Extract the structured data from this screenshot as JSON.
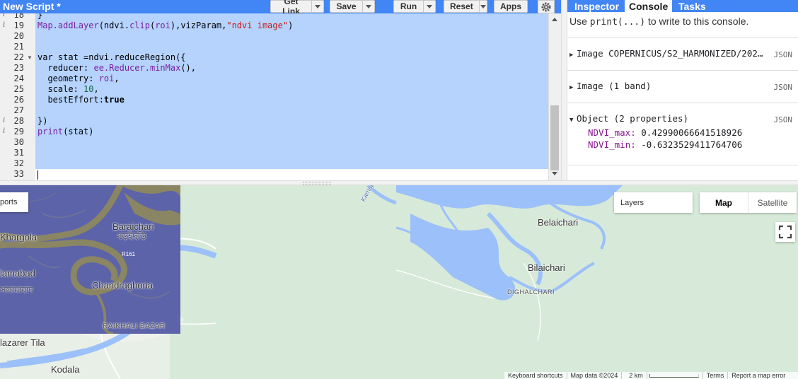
{
  "editor": {
    "title": "New Script *",
    "buttons": {
      "get_link": "Get Link",
      "save": "Save",
      "run": "Run",
      "reset": "Reset",
      "apps": "Apps"
    },
    "line_numbers": [
      "18",
      "19",
      "20",
      "21",
      "22",
      "23",
      "24",
      "25",
      "26",
      "27",
      "28",
      "29",
      "30",
      "31",
      "32",
      "33"
    ],
    "lines": {
      "l18": "}",
      "l19_fn": "Map.addLayer",
      "l19_a": "(ndvi.",
      "l19_clip": "clip",
      "l19_b": "(",
      "l19_roi": "roi",
      "l19_c": "),vizParam,",
      "l19_str": "\"ndvi image\"",
      "l19_d": ")",
      "l22": "var stat =ndvi.reduceRegion({",
      "l23_key": "  reducer: ",
      "l23_val": "ee.Reducer.minMax",
      "l23_end": "(),",
      "l24_key": "  geometry: ",
      "l24_val": "roi",
      "l24_end": ",",
      "l25_key": "  scale: ",
      "l25_val": "10",
      "l25_end": ",",
      "l26_key": "  bestEffort:",
      "l26_val": "true",
      "l28": "})",
      "l29_fn": "print",
      "l29_rest": "(stat)"
    }
  },
  "right_panel": {
    "tabs": {
      "inspector": "Inspector",
      "console": "Console",
      "tasks": "Tasks"
    },
    "hint_pre": "Use ",
    "hint_code": "print(...)",
    "hint_post": " to write to this console.",
    "entries": {
      "e1": "Image COPERNICUS/S2_HARMONIZED/202…",
      "e2": "Image (1 band)",
      "e3": "Object (2 properties)"
    },
    "json_label": "JSON",
    "props": {
      "max_key": "NDVI_max:",
      "max_val": "0.42990066641518926",
      "min_key": "NDVI_min:",
      "min_val": "-0.6323529411764706"
    }
  },
  "map": {
    "labels": {
      "khargola": "Khargola",
      "baraichari": "Baraichari",
      "baraichari_bn": "বড়ইছড়ি",
      "r161": "R161",
      "lamabad": "lamabad",
      "lamabad_bn": "সলামাবাদ",
      "chandraghona": "Chandraghona",
      "raikhali": "RAIKHALI BAZAR",
      "nazarer": "lazarer Tila",
      "kodala": "Kodala",
      "belaichari": "Belaichari",
      "bilaichari": "Bilaichari",
      "dighalchari": "DIGHALCHARI",
      "river": "Karnaphuli River"
    },
    "imports_label": "ports",
    "layers_label": "Layers",
    "map_type": {
      "map": "Map",
      "satellite": "Satellite"
    },
    "footer": {
      "shortcuts": "Keyboard shortcuts",
      "data": "Map data ©2024",
      "scale": "2 km",
      "terms": "Terms",
      "report": "Report a map error"
    }
  },
  "colors": {
    "accent": "#4285f4",
    "selection": "#b5d3fd",
    "overlay_low": "#5c63a8",
    "overlay_high": "#8a8562",
    "water": "#9cc0f9",
    "land": "#d7ead9"
  }
}
